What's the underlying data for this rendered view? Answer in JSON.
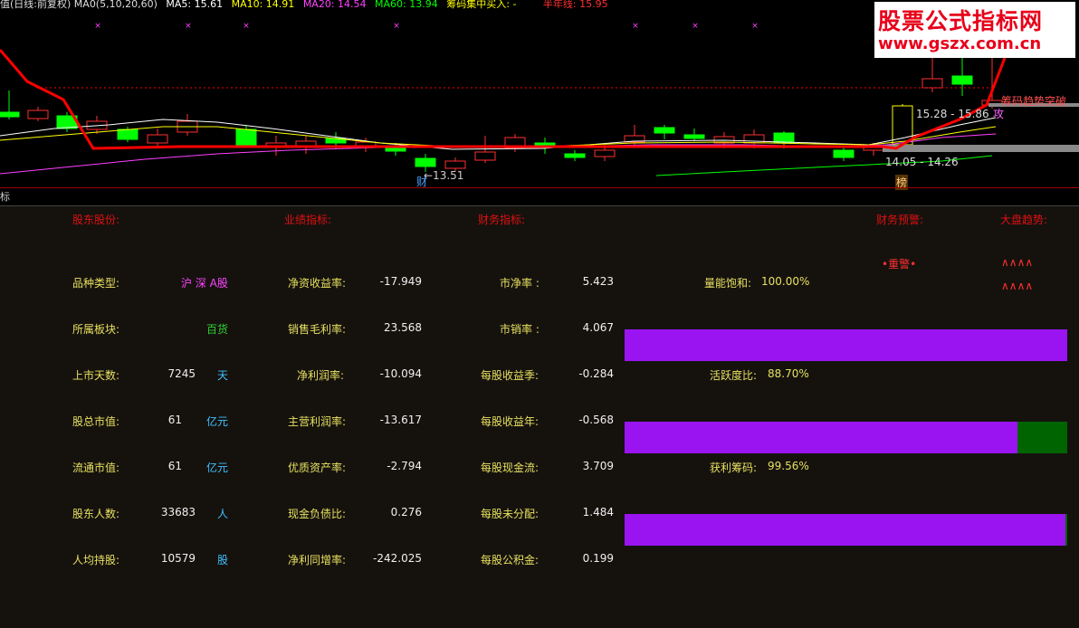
{
  "chart": {
    "title": "值(日线:前复权)",
    "ma_params": "MA0(5,10,20,60)",
    "ma5": "MA5: 15.61",
    "ma10": "MA10: 14.91",
    "ma20": "MA20: 14.54",
    "ma60": "MA60: 13.94",
    "chip_buy": "筹码集中买入: -",
    "half_year_line": "半年线: 15.95",
    "low_label": "←13.51",
    "caption_cai": "财",
    "price_range_high": "15.28 - 15.86",
    "price_range_low": "14.05 - 14.26",
    "caption_bang": "榜",
    "caption_gong": "攻",
    "breakout": "筹码趋势突破",
    "colors": {
      "up": "#ff3030",
      "down": "#00ff00",
      "ma5": "#ffffff",
      "ma10": "#ffff00",
      "ma20": "#ff40ff",
      "ma60": "#00ff00",
      "trend": "#ff0000"
    }
  },
  "logo": {
    "title": "股票公式指标网",
    "url": "www.gszx.com.cn"
  },
  "indicator_tab": "标",
  "panel": {
    "headers": {
      "shareholder": "股东股份:",
      "performance": "业绩指标:",
      "finance": "财务指标:",
      "warning": "财务预警:",
      "market_trend": "大盘趋势:"
    },
    "warning_value": "•重警•",
    "market_trend_1": "∧∧∧∧",
    "market_trend_2": "∧∧∧∧",
    "col1": [
      {
        "label": "品种类型:",
        "value": "",
        "unit": "沪 深 A股"
      },
      {
        "label": "所属板块:",
        "value": "",
        "unit": "百货"
      },
      {
        "label": "上市天数:",
        "value": "7245",
        "unit": "天"
      },
      {
        "label": "股总市值:",
        "value": "61",
        "unit": "亿元"
      },
      {
        "label": "流通市值:",
        "value": "61",
        "unit": "亿元"
      },
      {
        "label": "股东人数:",
        "value": "33683",
        "unit": "人"
      },
      {
        "label": "人均持股:",
        "value": "10579",
        "unit": "股"
      }
    ],
    "col2": [
      {
        "label": "净资收益率:",
        "value": "-17.949"
      },
      {
        "label": "销售毛利率:",
        "value": "23.568"
      },
      {
        "label": "净利润率:",
        "value": "-10.094"
      },
      {
        "label": "主营利润率:",
        "value": "-13.617"
      },
      {
        "label": "优质资产率:",
        "value": "-2.794"
      },
      {
        "label": "现金负债比:",
        "value": "0.276"
      },
      {
        "label": "净利同增率:",
        "value": "-242.025"
      }
    ],
    "col3": [
      {
        "label": "市净率 :",
        "value": "5.423"
      },
      {
        "label": "市销率 :",
        "value": "4.067"
      },
      {
        "label": "每股收益季:",
        "value": "-0.284"
      },
      {
        "label": "每股收益年:",
        "value": "-0.568"
      },
      {
        "label": "每股现金流:",
        "value": "3.709"
      },
      {
        "label": "每股未分配:",
        "value": "1.484"
      },
      {
        "label": "每股公积金:",
        "value": "0.199"
      }
    ],
    "metrics": [
      {
        "label": "量能饱和:",
        "value": "100.00%",
        "level": 1.0
      },
      {
        "label": "活跃度比:",
        "value": "88.70%",
        "level": 0.887
      },
      {
        "label": "获利筹码:",
        "value": "99.56%",
        "level": 0.9956
      }
    ]
  }
}
